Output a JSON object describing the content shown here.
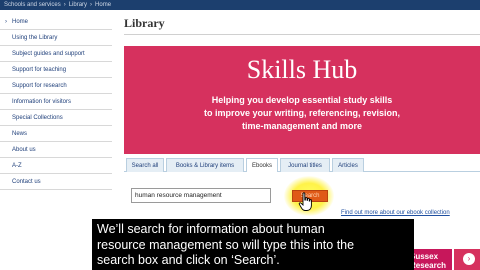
{
  "breadcrumb": [
    "Schools and services",
    "Library",
    "Home"
  ],
  "sidebar": {
    "items": [
      {
        "label": "Home"
      },
      {
        "label": "Using the Library"
      },
      {
        "label": "Subject guides and support"
      },
      {
        "label": "Support for teaching"
      },
      {
        "label": "Support for research"
      },
      {
        "label": "Information for visitors"
      },
      {
        "label": "Special Collections"
      },
      {
        "label": "News"
      },
      {
        "label": "About us"
      },
      {
        "label": "A-Z"
      },
      {
        "label": "Contact us"
      }
    ]
  },
  "page": {
    "title": "Library"
  },
  "banner": {
    "title": "Skills Hub",
    "line1": "Helping you develop essential study skills",
    "line2": "to improve your writing, referencing, revision,",
    "line3": "time-management and more",
    "color": "#d6315e"
  },
  "tabs": [
    {
      "label": "Search all"
    },
    {
      "label": "Books & Library items"
    },
    {
      "label": "Ebooks",
      "active": true
    },
    {
      "label": "Journal titles"
    },
    {
      "label": "Articles"
    }
  ],
  "search": {
    "value": "human resource management",
    "button_label": "Search",
    "link": "Find out more about our ebook collection"
  },
  "promo": {
    "label_line1": "Sussex",
    "label_line2": "Research"
  },
  "caption": {
    "line1": "We’ll search for information about human",
    "line2": "resource management so will type this into the",
    "line3": "search box and click on ‘Search’."
  },
  "colors": {
    "accent": "#d6315e",
    "nav": "#1c3f6e",
    "button": "#e05a17"
  }
}
